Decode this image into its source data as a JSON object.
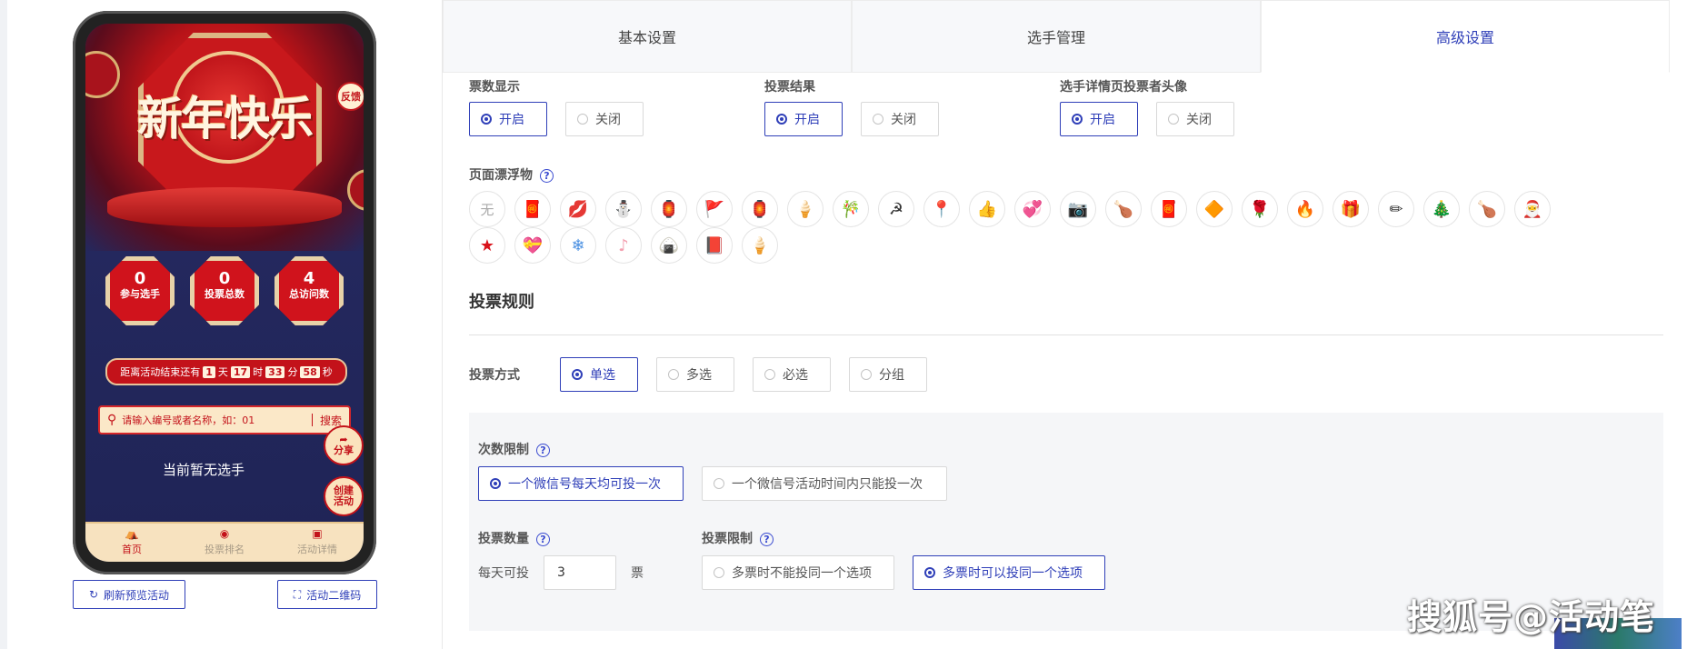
{
  "phone": {
    "hero_title": "新年快乐",
    "feedback": "反馈",
    "stats": [
      {
        "num": "0",
        "label": "参与选手"
      },
      {
        "num": "0",
        "label": "投票总数"
      },
      {
        "num": "4",
        "label": "总访问数"
      }
    ],
    "countdown": {
      "prefix": "距离活动结束还有",
      "days": "1",
      "d_unit": "天",
      "hours": "17",
      "h_unit": "时",
      "minutes": "33",
      "m_unit": "分",
      "seconds": "58",
      "s_unit": "秒"
    },
    "search": {
      "placeholder": "请输入编号或者名称，如：01",
      "button": "搜索"
    },
    "share": "分享",
    "create": [
      "创建",
      "活动"
    ],
    "empty": "当前暂无选手",
    "tabbar": [
      {
        "label": "首页",
        "icon": "home-icon"
      },
      {
        "label": "投票排名",
        "icon": "ranking-icon"
      },
      {
        "label": "活动详情",
        "icon": "detail-icon"
      }
    ]
  },
  "actions": {
    "refresh": "刷新预览活动",
    "qrcode": "活动二维码"
  },
  "tabs": [
    "基本设置",
    "选手管理",
    "高级设置"
  ],
  "settings": {
    "vote_count_display": {
      "label": "票数显示",
      "on": "开启",
      "off": "关闭"
    },
    "vote_result": {
      "label": "投票结果",
      "on": "开启",
      "off": "关闭"
    },
    "voter_avatar": {
      "label": "选手详情页投票者头像",
      "on": "开启",
      "off": "关闭"
    },
    "float_label": "页面漂浮物",
    "float_none": "无",
    "float_icons_row1": [
      "🧧",
      "💋",
      "⛄",
      "🏮",
      "🚩",
      "🏮",
      "🍦",
      "🎋",
      "☭",
      "📍",
      "👍",
      "💞",
      "📷",
      "🍗",
      "🧧",
      "🔶",
      "🌹",
      "🔥",
      "🎁",
      "✏",
      "🎄",
      "🍗",
      "🎅"
    ],
    "float_icons_row2": [
      "★",
      "💝",
      "❄",
      "♪",
      "🍙",
      "📕",
      "🍦"
    ],
    "rules_title": "投票规则",
    "vote_mode": {
      "label": "投票方式",
      "options": [
        "单选",
        "多选",
        "必选",
        "分组"
      ]
    },
    "count_limit": {
      "label": "次数限制",
      "options": [
        "一个微信号每天均可投一次",
        "一个微信号活动时间内只能投一次"
      ]
    },
    "vote_qty": {
      "label": "投票数量",
      "per_day": "每天可投",
      "value": "3",
      "unit": "票"
    },
    "vote_limit": {
      "label": "投票限制",
      "options": [
        "多票时不能投同一个选项",
        "多票时可以投同一个选项"
      ]
    }
  },
  "watermark": "搜狐号@活动笔",
  "colors": {
    "accent": "#2f3fb8",
    "festive_red": "#c3121a"
  }
}
